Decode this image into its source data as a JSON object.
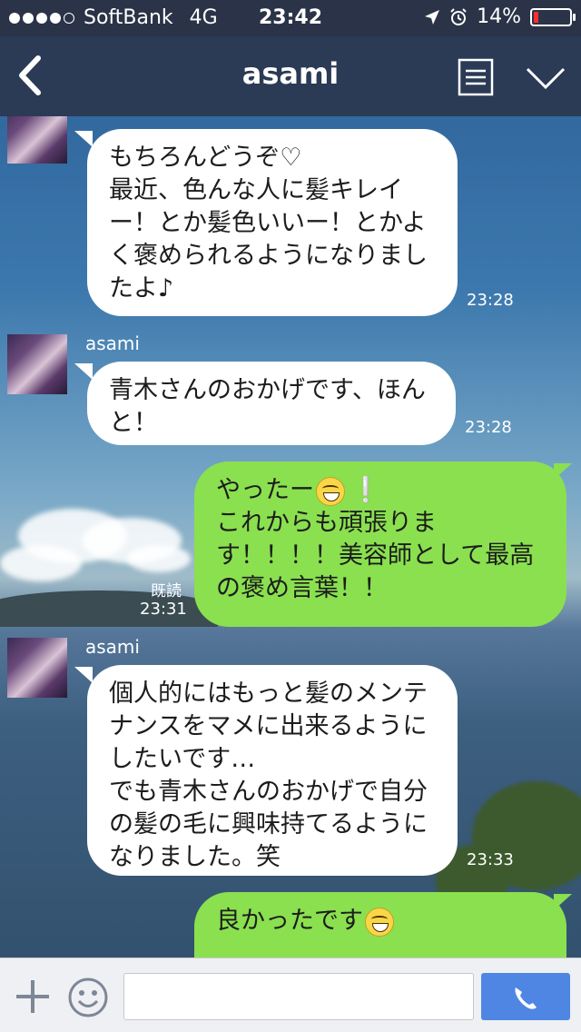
{
  "status_bar": {
    "carrier": "SoftBank",
    "network": "4G",
    "time": "23:42",
    "battery_percent": "14%",
    "battery_level": 0.14,
    "signal_bars_filled": 4,
    "signal_bars_total": 5
  },
  "nav": {
    "title": "asami"
  },
  "messages": [
    {
      "direction": "in",
      "sender": "asami",
      "text": "もちろんどうぞ♡\n最近、色んな人に髪キレイー！とか髪色いいー！とかよく褒められるようになりましたよ♪",
      "time": "23:28"
    },
    {
      "direction": "in",
      "sender": "asami",
      "text": "青木さんのおかげです、ほんと！",
      "time": "23:28"
    },
    {
      "direction": "out",
      "read": "既読",
      "time": "23:31",
      "line1": "やったー",
      "line2": "これからも頑張ります！！！！美容師として最高の褒め言葉！！"
    },
    {
      "direction": "in",
      "sender": "asami",
      "text": "個人的にはもっと髪のメンテナンスをマメに出来るようにしたいです…\nでも青木さんのおかげで自分の髪の毛に興味持てるようになりました。笑",
      "time": "23:33"
    },
    {
      "direction": "out",
      "line1": "良かったです"
    }
  ],
  "input": {
    "value": "",
    "placeholder": ""
  },
  "colors": {
    "incoming_bubble": "#ffffff",
    "outgoing_bubble": "#8ae04f",
    "nav_bar": "#2b3a55",
    "call_button": "#4f86e3"
  },
  "icons": {
    "back": "chevron-left-icon",
    "menu": "list-icon",
    "collapse": "chevron-down-icon",
    "add": "plus-icon",
    "emoji": "smiley-icon",
    "call": "phone-icon",
    "location": "location-arrow-icon",
    "alarm": "alarm-icon"
  }
}
